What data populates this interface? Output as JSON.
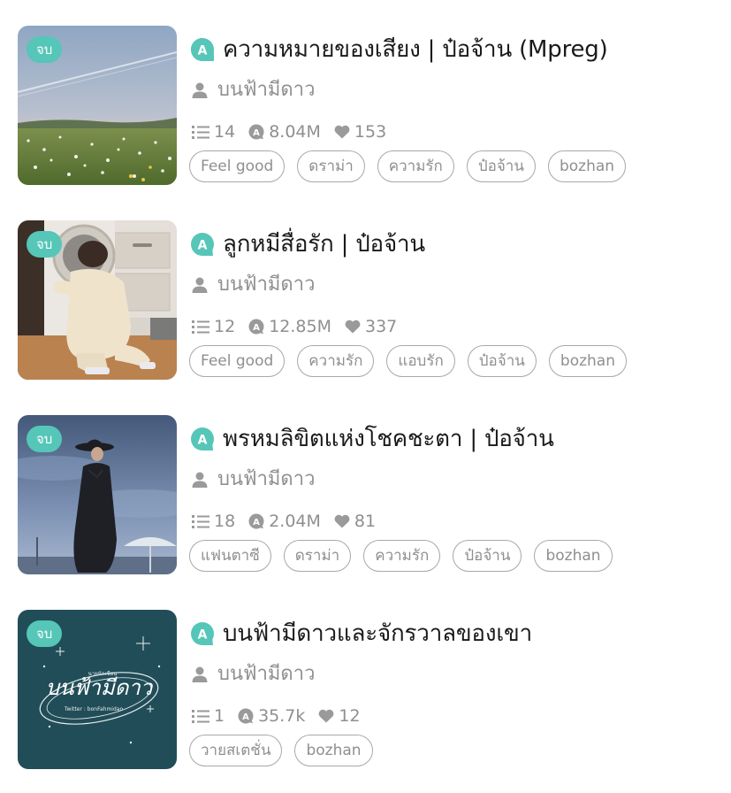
{
  "stories": [
    {
      "status": "จบ",
      "title": "ความหมายของเสียง | ป๋อจ้าน (Mpreg)",
      "author": "บนฟ้ามีดาว",
      "chapters": "14",
      "views": "8.04M",
      "likes": "153",
      "tags": [
        "Feel good",
        "ดราม่า",
        "ความรัก",
        "ป๋อจ้าน",
        "bozhan"
      ],
      "cover": "meadow-sky-photo"
    },
    {
      "status": "จบ",
      "title": "ลูกหมีสื่อรัก | ป๋อจ้าน",
      "author": "บนฟ้ามีดาว",
      "chapters": "12",
      "views": "12.85M",
      "likes": "337",
      "tags": [
        "Feel good",
        "ความรัก",
        "แอบรัก",
        "ป๋อจ้าน",
        "bozhan"
      ],
      "cover": "toddler-washing-machine-photo"
    },
    {
      "status": "จบ",
      "title": "พรหมลิขิตแห่งโชคชะตา | ป๋อจ้าน",
      "author": "บนฟ้ามีดาว",
      "chapters": "18",
      "views": "2.04M",
      "likes": "81",
      "tags": [
        "แฟนตาซี",
        "ดราม่า",
        "ความรัก",
        "ป๋อจ้าน",
        "bozhan"
      ],
      "cover": "man-in-coat-blue-sky-photo"
    },
    {
      "status": "จบ",
      "title": "บนฟ้ามีดาวและจักรวาลของเขา",
      "author": "บนฟ้ามีดาว",
      "chapters": "1",
      "views": "35.7k",
      "likes": "12",
      "tags": [
        "วายสเตชั่น",
        "bozhan"
      ],
      "cover": "handwritten-title-cover",
      "cover_text": {
        "small": "นายนักเขียน",
        "script": "บนฟ้ามีดาว",
        "twitter": "Twitter : bonFahmidao"
      }
    }
  ],
  "colors": {
    "accent": "#55c6b7",
    "title": "#1a1a1a",
    "meta": "#8f8f8f",
    "tag_border": "#a8a8a8"
  },
  "icons": {
    "a_badge": "a-badge-icon",
    "author": "person-icon",
    "chapters": "list-icon",
    "views": "views-icon",
    "likes": "heart-icon"
  }
}
